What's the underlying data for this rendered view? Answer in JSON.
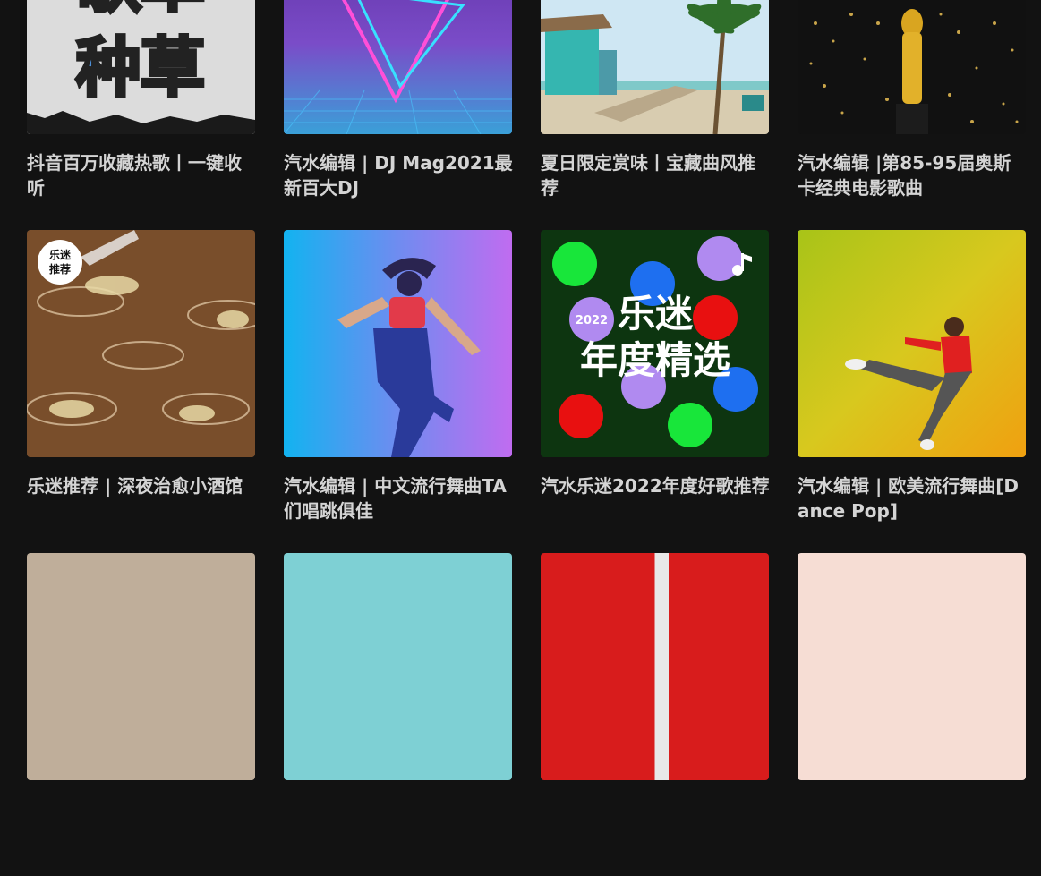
{
  "playlists": [
    {
      "title": "抖音百万收藏热歌丨一键收听",
      "cover_text": [
        "歌单",
        "种草"
      ]
    },
    {
      "title": "汽水编辑 | DJ Mag2021最新百大DJ"
    },
    {
      "title": "夏日限定赏味丨宝藏曲风推荐"
    },
    {
      "title": "汽水编辑 |第85-95届奥斯卡经典电影歌曲"
    },
    {
      "title": "乐迷推荐 | 深夜治愈小酒馆",
      "badge": [
        "乐迷",
        "推荐"
      ]
    },
    {
      "title": "汽水编辑 | 中文流行舞曲TA们唱跳俱佳"
    },
    {
      "title": "汽水乐迷2022年度好歌推荐",
      "cover_text": [
        "乐迷",
        "年度精选"
      ],
      "year_badge": "2022"
    },
    {
      "title": "汽水编辑 | 欧美流行舞曲[Dance Pop]"
    },
    {
      "title": ""
    },
    {
      "title": ""
    },
    {
      "title": ""
    },
    {
      "title": ""
    }
  ],
  "colors": {
    "background": "#121212",
    "title_text": "#d4d4d4"
  }
}
